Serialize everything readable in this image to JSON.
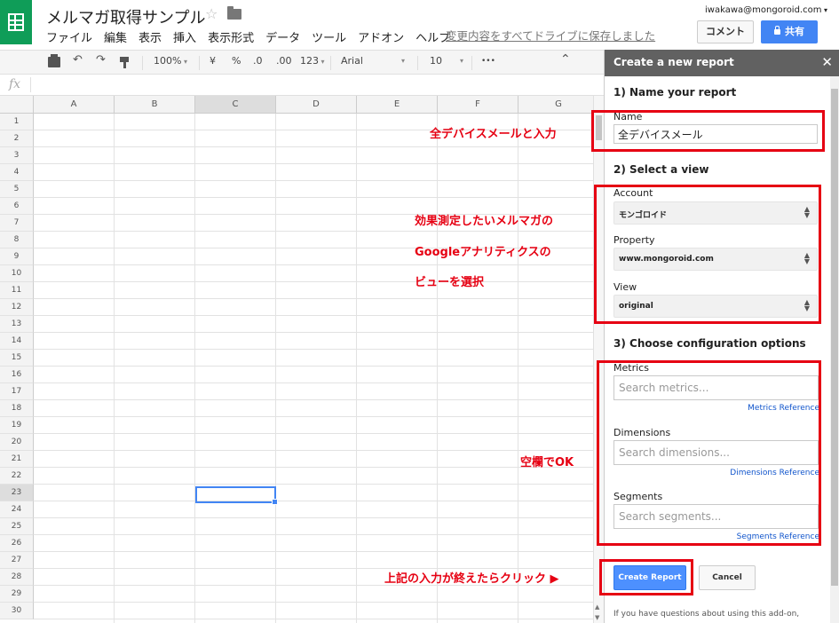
{
  "header": {
    "doc_title": "メルマガ取得サンプル",
    "menu": [
      "ファイル",
      "編集",
      "表示",
      "挿入",
      "表示形式",
      "データ",
      "ツール",
      "アドオン",
      "ヘルプ"
    ],
    "save_status": "変更内容をすべてドライブに保存しました",
    "user_email": "iwakawa@mongoroid.com",
    "comment_label": "コメント",
    "share_label": "共有"
  },
  "toolbar": {
    "zoom": "100%",
    "currency": "¥",
    "percent": "%",
    "decrease_decimal": ".0",
    "increase_decimal": ".00",
    "number_format": "123",
    "font": "Arial",
    "font_size": "10",
    "more": "•••"
  },
  "formula_bar": {
    "fx": "fx"
  },
  "grid": {
    "columns": [
      "A",
      "B",
      "C",
      "D",
      "E",
      "F",
      "G"
    ],
    "rows": [
      "1",
      "2",
      "3",
      "4",
      "5",
      "6",
      "7",
      "8",
      "9",
      "10",
      "11",
      "12",
      "13",
      "14",
      "15",
      "16",
      "17",
      "18",
      "19",
      "20",
      "21",
      "22",
      "23",
      "24",
      "25",
      "26",
      "27",
      "28",
      "29",
      "30"
    ],
    "selected_column": "C",
    "selected_row": "23"
  },
  "sidebar": {
    "title": "Create a new report",
    "section1": "1) Name your report",
    "name_label": "Name",
    "name_value": "全デバイスメール",
    "section2": "2) Select a view",
    "account_label": "Account",
    "account_value": "モンゴロイド",
    "property_label": "Property",
    "property_value": "www.mongoroid.com",
    "view_label": "View",
    "view_value": "original",
    "section3": "3) Choose configuration options",
    "metrics_label": "Metrics",
    "metrics_placeholder": "Search metrics...",
    "metrics_ref": "Metrics Reference",
    "dimensions_label": "Dimensions",
    "dimensions_placeholder": "Search dimensions...",
    "dimensions_ref": "Dimensions Reference",
    "segments_label": "Segments",
    "segments_placeholder": "Search segments...",
    "segments_ref": "Segments Reference",
    "create_label": "Create Report",
    "cancel_label": "Cancel",
    "help_text": "If you have questions about using this add-on,"
  },
  "annotations": {
    "name_note": "全デバイスメールと入力",
    "view_note_1": "効果測定したいメルマガの",
    "view_note_2": "Googleアナリティクスの",
    "view_note_3": "ビューを選択",
    "blank_note": "空欄でOK",
    "click_note": "上記の入力が終えたらクリック"
  },
  "colors": {
    "sheets_green": "#0f9d58",
    "share_blue": "#4285f4",
    "annotation_red": "#e60012",
    "sidebar_header": "#616161"
  }
}
